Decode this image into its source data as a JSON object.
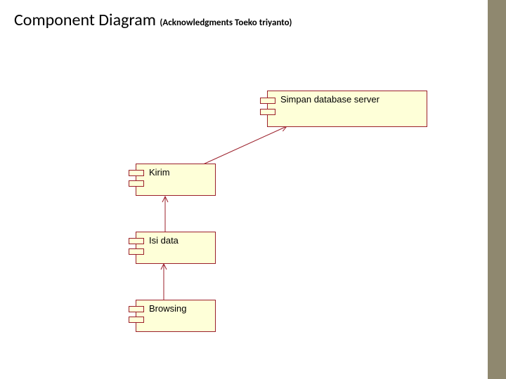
{
  "title": {
    "main": "Component Diagram",
    "sub": "(Acknowledgments Toeko triyanto)"
  },
  "components": {
    "simpan": "Simpan database server",
    "kirim": "Kirim",
    "isi": "Isi data",
    "browsing": "Browsing"
  },
  "diagram": {
    "type": "uml-component-diagram",
    "nodes": [
      {
        "id": "simpan",
        "label": "Simpan database server"
      },
      {
        "id": "kirim",
        "label": "Kirim"
      },
      {
        "id": "isi",
        "label": "Isi data"
      },
      {
        "id": "browsing",
        "label": "Browsing"
      }
    ],
    "edges": [
      {
        "from": "kirim",
        "to": "simpan",
        "kind": "dependency"
      },
      {
        "from": "isi",
        "to": "kirim",
        "kind": "dependency"
      },
      {
        "from": "browsing",
        "to": "isi",
        "kind": "dependency"
      }
    ]
  },
  "colors": {
    "componentFill": "#feffd8",
    "componentStroke": "#9b1f2a",
    "arrowStroke": "#9b1f2a",
    "sidebar": "#8f886f"
  }
}
